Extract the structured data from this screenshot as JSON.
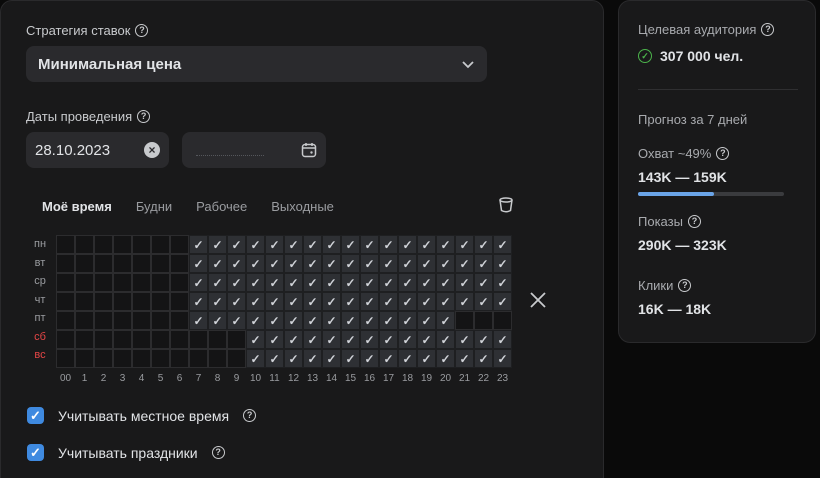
{
  "bid_strategy": {
    "label": "Стратегия ставок",
    "value": "Минимальная цена"
  },
  "dates": {
    "label": "Даты проведения",
    "start": "28.10.2023",
    "end_placeholder": "__.__.____"
  },
  "schedule": {
    "tabs": [
      "Моё время",
      "Будни",
      "Рабочее",
      "Выходные"
    ],
    "days": [
      "пн",
      "вт",
      "ср",
      "чт",
      "пт",
      "сб",
      "вс"
    ],
    "weekend_days": [
      "сб",
      "вс"
    ],
    "hours": [
      "00",
      "1",
      "2",
      "3",
      "4",
      "5",
      "6",
      "7",
      "8",
      "9",
      "10",
      "11",
      "12",
      "13",
      "14",
      "15",
      "16",
      "17",
      "18",
      "19",
      "20",
      "21",
      "22",
      "23"
    ],
    "active_ranges": [
      [
        7,
        23
      ],
      [
        7,
        23
      ],
      [
        7,
        23
      ],
      [
        7,
        23
      ],
      [
        7,
        20
      ],
      [
        10,
        23
      ],
      [
        10,
        23
      ]
    ]
  },
  "options": [
    {
      "label": "Учитывать местное время",
      "checked": true
    },
    {
      "label": "Учитывать праздники",
      "checked": true
    }
  ],
  "audience": {
    "label": "Целевая аудитория",
    "value": "307 000 чел."
  },
  "forecast": {
    "title": "Прогноз за 7 дней",
    "reach": {
      "label": "Охват ~49%",
      "value": "143K — 159K",
      "fraction": 0.52
    },
    "impressions": {
      "label": "Показы",
      "value": "290K — 323K"
    },
    "clicks": {
      "label": "Клики",
      "value": "16K — 18K"
    }
  },
  "colors": {
    "accent": "#3f8ae0",
    "ok": "#4bb34b",
    "weekend": "#e64646"
  }
}
